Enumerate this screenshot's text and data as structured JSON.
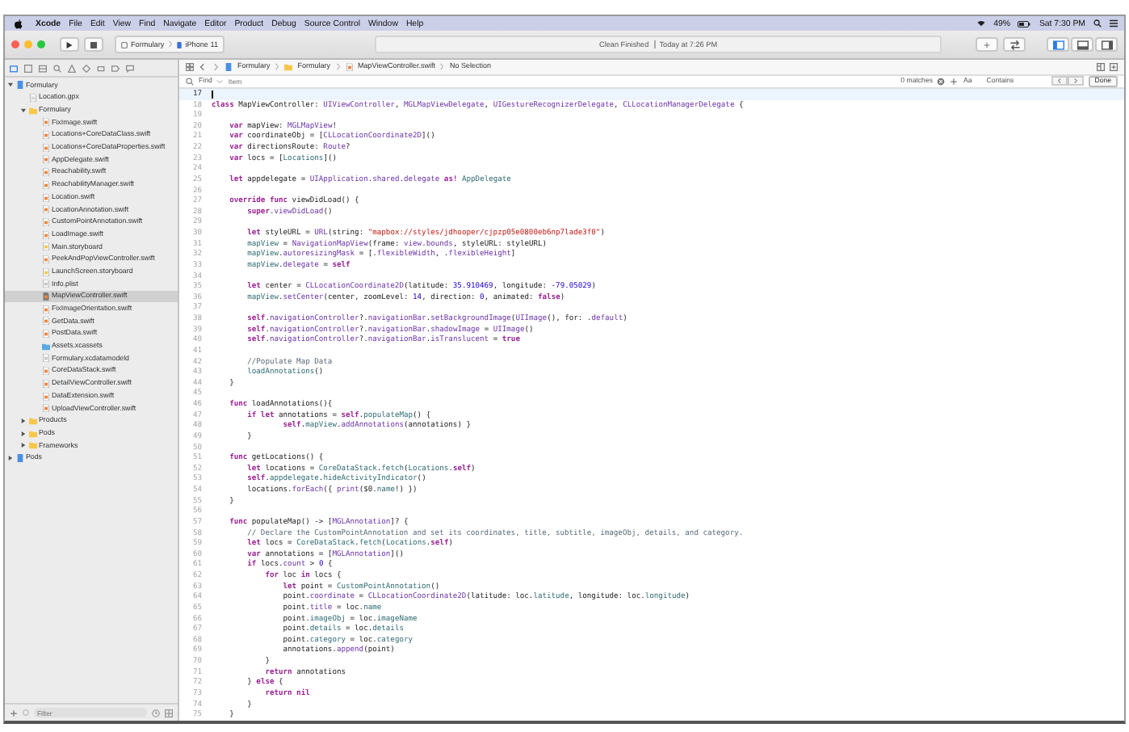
{
  "menu_bar": {
    "app": "Xcode",
    "items": [
      "File",
      "Edit",
      "View",
      "Find",
      "Navigate",
      "Editor",
      "Product",
      "Debug",
      "Source Control",
      "Window",
      "Help"
    ],
    "battery": "49%",
    "clock": "Sat 7:30 PM"
  },
  "toolbar": {
    "scheme": "Formulary",
    "device": "iPhone 11",
    "activity": "Clean Finished",
    "activity_time": "Today at 7:26 PM"
  },
  "jump_bar": [
    "Formulary",
    "Formulary",
    "MapViewController.swift",
    "No Selection"
  ],
  "find_bar": {
    "mode": "Find",
    "placeholder": "Item",
    "matches": "0 matches",
    "case": "Aa",
    "match_type": "Contains",
    "done": "Done"
  },
  "navigator": {
    "filter_placeholder": "Filter",
    "tree": [
      {
        "name": "Formulary",
        "kind": "project",
        "selected": false,
        "expanded": true,
        "children": [
          {
            "name": "Location.gpx",
            "kind": "gpx",
            "selected": false
          },
          {
            "name": "Formulary",
            "kind": "folder",
            "selected": false,
            "expanded": true,
            "children": [
              {
                "name": "FixImage.swift",
                "kind": "swift",
                "selected": false
              },
              {
                "name": "Locations+CoreDataClass.swift",
                "kind": "swift",
                "selected": false
              },
              {
                "name": "Locations+CoreDataProperties.swift",
                "kind": "swift",
                "selected": false
              },
              {
                "name": "AppDelegate.swift",
                "kind": "swift",
                "selected": false
              },
              {
                "name": "Reachability.swift",
                "kind": "swift",
                "selected": false
              },
              {
                "name": "ReachabilityManager.swift",
                "kind": "swift",
                "selected": false
              },
              {
                "name": "Location.swift",
                "kind": "swift",
                "selected": false
              },
              {
                "name": "LocationAnnotation.swift",
                "kind": "swift",
                "selected": false
              },
              {
                "name": "CustomPointAnnotation.swift",
                "kind": "swift",
                "selected": false
              },
              {
                "name": "LoadImage.swift",
                "kind": "swift",
                "selected": false
              },
              {
                "name": "Main.storyboard",
                "kind": "storyboard",
                "selected": false
              },
              {
                "name": "PeekAndPopViewController.swift",
                "kind": "swift",
                "selected": false
              },
              {
                "name": "LaunchScreen.storyboard",
                "kind": "storyboard",
                "selected": false
              },
              {
                "name": "Info.plist",
                "kind": "plist",
                "selected": false
              },
              {
                "name": "MapViewController.swift",
                "kind": "swift",
                "selected": true
              },
              {
                "name": "FixImageOrientation.swift",
                "kind": "swift",
                "selected": false
              },
              {
                "name": "GetData.swift",
                "kind": "swift",
                "selected": false
              },
              {
                "name": "PostData.swift",
                "kind": "swift",
                "selected": false
              },
              {
                "name": "Assets.xcassets",
                "kind": "assets",
                "selected": false
              },
              {
                "name": "Formulary.xcdatamodeld",
                "kind": "model",
                "selected": false
              },
              {
                "name": "CoreDataStack.swift",
                "kind": "swift",
                "selected": false
              },
              {
                "name": "DetailViewController.swift",
                "kind": "swift",
                "selected": false
              },
              {
                "name": "DataExtension.swift",
                "kind": "swift",
                "selected": false
              },
              {
                "name": "UploadViewController.swift",
                "kind": "swift",
                "selected": false
              }
            ]
          },
          {
            "name": "Products",
            "kind": "folder",
            "selected": false,
            "expanded": false
          },
          {
            "name": "Pods",
            "kind": "folder",
            "selected": false,
            "expanded": false
          },
          {
            "name": "Frameworks",
            "kind": "folder",
            "selected": false,
            "expanded": false
          }
        ]
      },
      {
        "name": "Pods",
        "kind": "project",
        "selected": false,
        "expanded": false
      }
    ]
  },
  "editor": {
    "lines": [
      {
        "number": "17",
        "current": true
      },
      {
        "number": "18",
        "current": false,
        "tokens": [
          {
            "kind": "kw",
            "text": "class"
          },
          {
            "kind": "plain",
            "text": " MapViewController: "
          },
          {
            "kind": "type",
            "text": "UIViewController"
          },
          {
            "kind": "plain",
            "text": ", "
          },
          {
            "kind": "type",
            "text": "MGLMapViewDelegate"
          },
          {
            "kind": "plain",
            "text": ", "
          },
          {
            "kind": "type",
            "text": "UIGestureRecognizerDelegate"
          },
          {
            "kind": "plain",
            "text": ", "
          },
          {
            "kind": "type",
            "text": "CLLocationManagerDelegate"
          },
          {
            "kind": "plain",
            "text": " {"
          }
        ]
      },
      {
        "number": "19",
        "current": false
      },
      {
        "number": "20",
        "current": false,
        "tokens": [
          {
            "kind": "kw",
            "text": "    var"
          },
          {
            "kind": "plain",
            "text": " mapView: "
          },
          {
            "kind": "type",
            "text": "MGLMapView"
          },
          {
            "kind": "plain",
            "text": "!"
          }
        ]
      },
      {
        "number": "21",
        "current": false,
        "tokens": [
          {
            "kind": "kw",
            "text": "    var"
          },
          {
            "kind": "plain",
            "text": " coordinateObj = ["
          },
          {
            "kind": "type",
            "text": "CLLocationCoordinate2D"
          },
          {
            "kind": "plain",
            "text": "]()"
          }
        ]
      },
      {
        "number": "22",
        "current": false,
        "tokens": [
          {
            "kind": "kw",
            "text": "    var"
          },
          {
            "kind": "plain",
            "text": " directionsRoute: "
          },
          {
            "kind": "type",
            "text": "Route"
          },
          {
            "kind": "plain",
            "text": "?"
          }
        ]
      },
      {
        "number": "23",
        "current": false,
        "tokens": [
          {
            "kind": "kw",
            "text": "    var"
          },
          {
            "kind": "plain",
            "text": " locs = ["
          },
          {
            "kind": "proj",
            "text": "Locations"
          },
          {
            "kind": "plain",
            "text": "]()"
          }
        ]
      },
      {
        "number": "24",
        "current": false
      },
      {
        "number": "25",
        "current": false,
        "tokens": [
          {
            "kind": "kw",
            "text": "    let"
          },
          {
            "kind": "plain",
            "text": " appdelegate = "
          },
          {
            "kind": "type",
            "text": "UIApplication"
          },
          {
            "kind": "plain",
            "text": "."
          },
          {
            "kind": "type",
            "text": "shared"
          },
          {
            "kind": "plain",
            "text": "."
          },
          {
            "kind": "type",
            "text": "delegate"
          },
          {
            "kind": "kw",
            "text": " as!"
          },
          {
            "kind": "proj",
            "text": " AppDelegate"
          }
        ]
      },
      {
        "number": "26",
        "current": false
      },
      {
        "number": "27",
        "current": false,
        "tokens": [
          {
            "kind": "kw",
            "text": "    override func"
          },
          {
            "kind": "plain",
            "text": " viewDidLoad() {"
          }
        ]
      },
      {
        "number": "28",
        "current": false,
        "tokens": [
          {
            "kind": "kw",
            "text": "        super"
          },
          {
            "kind": "plain",
            "text": "."
          },
          {
            "kind": "type",
            "text": "viewDidLoad"
          },
          {
            "kind": "plain",
            "text": "()"
          }
        ]
      },
      {
        "number": "29",
        "current": false
      },
      {
        "number": "30",
        "current": false,
        "tokens": [
          {
            "kind": "kw",
            "text": "        let"
          },
          {
            "kind": "plain",
            "text": " styleURL = "
          },
          {
            "kind": "type",
            "text": "URL"
          },
          {
            "kind": "plain",
            "text": "(string: "
          },
          {
            "kind": "str",
            "text": "\"mapbox://styles/jdhooper/cjpzp05e0800eb6np7lade3f0\""
          },
          {
            "kind": "plain",
            "text": ")"
          }
        ]
      },
      {
        "number": "31",
        "current": false,
        "tokens": [
          {
            "kind": "proj",
            "text": "        mapView"
          },
          {
            "kind": "plain",
            "text": " = "
          },
          {
            "kind": "type",
            "text": "NavigationMapView"
          },
          {
            "kind": "plain",
            "text": "(frame: "
          },
          {
            "kind": "type",
            "text": "view"
          },
          {
            "kind": "plain",
            "text": "."
          },
          {
            "kind": "type",
            "text": "bounds"
          },
          {
            "kind": "plain",
            "text": ", styleURL: styleURL)"
          }
        ]
      },
      {
        "number": "32",
        "current": false,
        "tokens": [
          {
            "kind": "proj",
            "text": "        mapView"
          },
          {
            "kind": "plain",
            "text": "."
          },
          {
            "kind": "type",
            "text": "autoresizingMask"
          },
          {
            "kind": "plain",
            "text": " = [."
          },
          {
            "kind": "type",
            "text": "flexibleWidth"
          },
          {
            "kind": "plain",
            "text": ", ."
          },
          {
            "kind": "type",
            "text": "flexibleHeight"
          },
          {
            "kind": "plain",
            "text": "]"
          }
        ]
      },
      {
        "number": "33",
        "current": false,
        "tokens": [
          {
            "kind": "proj",
            "text": "        mapView"
          },
          {
            "kind": "plain",
            "text": "."
          },
          {
            "kind": "type",
            "text": "delegate"
          },
          {
            "kind": "plain",
            "text": " = "
          },
          {
            "kind": "kw",
            "text": "self"
          }
        ]
      },
      {
        "number": "34",
        "current": false
      },
      {
        "number": "35",
        "current": false,
        "tokens": [
          {
            "kind": "kw",
            "text": "        let"
          },
          {
            "kind": "plain",
            "text": " center = "
          },
          {
            "kind": "type",
            "text": "CLLocationCoordinate2D"
          },
          {
            "kind": "plain",
            "text": "(latitude: "
          },
          {
            "kind": "num",
            "text": "35.910469"
          },
          {
            "kind": "plain",
            "text": ", longitude: "
          },
          {
            "kind": "num",
            "text": "-79.05029"
          },
          {
            "kind": "plain",
            "text": ")"
          }
        ]
      },
      {
        "number": "36",
        "current": false,
        "tokens": [
          {
            "kind": "proj",
            "text": "        mapView"
          },
          {
            "kind": "plain",
            "text": "."
          },
          {
            "kind": "type",
            "text": "setCenter"
          },
          {
            "kind": "plain",
            "text": "(center, zoomLevel: "
          },
          {
            "kind": "num",
            "text": "14"
          },
          {
            "kind": "plain",
            "text": ", direction: "
          },
          {
            "kind": "num",
            "text": "0"
          },
          {
            "kind": "plain",
            "text": ", animated: "
          },
          {
            "kind": "kw",
            "text": "false"
          },
          {
            "kind": "plain",
            "text": ")"
          }
        ]
      },
      {
        "number": "37",
        "current": false
      },
      {
        "number": "38",
        "current": false,
        "tokens": [
          {
            "kind": "kw",
            "text": "        self"
          },
          {
            "kind": "plain",
            "text": "."
          },
          {
            "kind": "type",
            "text": "navigationController"
          },
          {
            "kind": "plain",
            "text": "?."
          },
          {
            "kind": "type",
            "text": "navigationBar"
          },
          {
            "kind": "plain",
            "text": "."
          },
          {
            "kind": "type",
            "text": "setBackgroundImage"
          },
          {
            "kind": "plain",
            "text": "("
          },
          {
            "kind": "type",
            "text": "UIImage"
          },
          {
            "kind": "plain",
            "text": "(), for: ."
          },
          {
            "kind": "type",
            "text": "default"
          },
          {
            "kind": "plain",
            "text": ")"
          }
        ]
      },
      {
        "number": "39",
        "current": false,
        "tokens": [
          {
            "kind": "kw",
            "text": "        self"
          },
          {
            "kind": "plain",
            "text": "."
          },
          {
            "kind": "type",
            "text": "navigationController"
          },
          {
            "kind": "plain",
            "text": "?."
          },
          {
            "kind": "type",
            "text": "navigationBar"
          },
          {
            "kind": "plain",
            "text": "."
          },
          {
            "kind": "type",
            "text": "shadowImage"
          },
          {
            "kind": "plain",
            "text": " = "
          },
          {
            "kind": "type",
            "text": "UIImage"
          },
          {
            "kind": "plain",
            "text": "()"
          }
        ]
      },
      {
        "number": "40",
        "current": false,
        "tokens": [
          {
            "kind": "kw",
            "text": "        self"
          },
          {
            "kind": "plain",
            "text": "."
          },
          {
            "kind": "type",
            "text": "navigationController"
          },
          {
            "kind": "plain",
            "text": "?."
          },
          {
            "kind": "type",
            "text": "navigationBar"
          },
          {
            "kind": "plain",
            "text": "."
          },
          {
            "kind": "type",
            "text": "isTranslucent"
          },
          {
            "kind": "plain",
            "text": " = "
          },
          {
            "kind": "kw",
            "text": "true"
          }
        ]
      },
      {
        "number": "41",
        "current": false
      },
      {
        "number": "42",
        "current": false,
        "tokens": [
          {
            "kind": "com",
            "text": "        //Populate Map Data"
          }
        ]
      },
      {
        "number": "43",
        "current": false,
        "tokens": [
          {
            "kind": "proj",
            "text": "        loadAnnotations"
          },
          {
            "kind": "plain",
            "text": "()"
          }
        ]
      },
      {
        "number": "44",
        "current": false,
        "tokens": [
          {
            "kind": "plain",
            "text": "    }"
          }
        ]
      },
      {
        "number": "45",
        "current": false
      },
      {
        "number": "46",
        "current": false,
        "tokens": [
          {
            "kind": "kw",
            "text": "    func"
          },
          {
            "kind": "plain",
            "text": " loadAnnotations(){"
          }
        ]
      },
      {
        "number": "47",
        "current": false,
        "tokens": [
          {
            "kind": "kw",
            "text": "        if let"
          },
          {
            "kind": "plain",
            "text": " annotations = "
          },
          {
            "kind": "kw",
            "text": "self"
          },
          {
            "kind": "plain",
            "text": "."
          },
          {
            "kind": "proj",
            "text": "populateMap"
          },
          {
            "kind": "plain",
            "text": "() {"
          }
        ]
      },
      {
        "number": "48",
        "current": false,
        "tokens": [
          {
            "kind": "kw",
            "text": "                self"
          },
          {
            "kind": "plain",
            "text": "."
          },
          {
            "kind": "proj",
            "text": "mapView"
          },
          {
            "kind": "plain",
            "text": "."
          },
          {
            "kind": "type",
            "text": "addAnnotations"
          },
          {
            "kind": "plain",
            "text": "(annotations) }"
          }
        ]
      },
      {
        "number": "49",
        "current": false,
        "tokens": [
          {
            "kind": "plain",
            "text": "        }"
          }
        ]
      },
      {
        "number": "50",
        "current": false
      },
      {
        "number": "51",
        "current": false,
        "tokens": [
          {
            "kind": "kw",
            "text": "    func"
          },
          {
            "kind": "plain",
            "text": " getLocations() {"
          }
        ]
      },
      {
        "number": "52",
        "current": false,
        "tokens": [
          {
            "kind": "kw",
            "text": "        let"
          },
          {
            "kind": "plain",
            "text": " locations = "
          },
          {
            "kind": "proj",
            "text": "CoreDataStack"
          },
          {
            "kind": "plain",
            "text": "."
          },
          {
            "kind": "proj",
            "text": "fetch"
          },
          {
            "kind": "plain",
            "text": "("
          },
          {
            "kind": "proj",
            "text": "Locations"
          },
          {
            "kind": "plain",
            "text": "."
          },
          {
            "kind": "kw",
            "text": "self"
          },
          {
            "kind": "plain",
            "text": ")"
          }
        ]
      },
      {
        "number": "53",
        "current": false,
        "tokens": [
          {
            "kind": "kw",
            "text": "        self"
          },
          {
            "kind": "plain",
            "text": "."
          },
          {
            "kind": "proj",
            "text": "appdelegate"
          },
          {
            "kind": "plain",
            "text": "."
          },
          {
            "kind": "proj",
            "text": "hideActivityIndicator"
          },
          {
            "kind": "plain",
            "text": "()"
          }
        ]
      },
      {
        "number": "54",
        "current": false,
        "tokens": [
          {
            "kind": "plain",
            "text": "        locations."
          },
          {
            "kind": "type",
            "text": "forEach"
          },
          {
            "kind": "plain",
            "text": "({ "
          },
          {
            "kind": "type",
            "text": "print"
          },
          {
            "kind": "plain",
            "text": "($0."
          },
          {
            "kind": "proj",
            "text": "name"
          },
          {
            "kind": "plain",
            "text": "!) })"
          }
        ]
      },
      {
        "number": "55",
        "current": false,
        "tokens": [
          {
            "kind": "plain",
            "text": "    }"
          }
        ]
      },
      {
        "number": "56",
        "current": false
      },
      {
        "number": "57",
        "current": false,
        "tokens": [
          {
            "kind": "kw",
            "text": "    func"
          },
          {
            "kind": "plain",
            "text": " populateMap() -> ["
          },
          {
            "kind": "type",
            "text": "MGLAnnotation"
          },
          {
            "kind": "plain",
            "text": "]? {"
          }
        ]
      },
      {
        "number": "58",
        "current": false,
        "tokens": [
          {
            "kind": "com",
            "text": "        // Declare the CustomPointAnnotation and set its coordinates, title, subtitle, imageObj, details, and category."
          }
        ]
      },
      {
        "number": "59",
        "current": false,
        "tokens": [
          {
            "kind": "kw",
            "text": "        let"
          },
          {
            "kind": "plain",
            "text": " locs = "
          },
          {
            "kind": "proj",
            "text": "CoreDataStack"
          },
          {
            "kind": "plain",
            "text": "."
          },
          {
            "kind": "proj",
            "text": "fetch"
          },
          {
            "kind": "plain",
            "text": "("
          },
          {
            "kind": "proj",
            "text": "Locations"
          },
          {
            "kind": "plain",
            "text": "."
          },
          {
            "kind": "kw",
            "text": "self"
          },
          {
            "kind": "plain",
            "text": ")"
          }
        ]
      },
      {
        "number": "60",
        "current": false,
        "tokens": [
          {
            "kind": "kw",
            "text": "        var"
          },
          {
            "kind": "plain",
            "text": " annotations = ["
          },
          {
            "kind": "type",
            "text": "MGLAnnotation"
          },
          {
            "kind": "plain",
            "text": "]()"
          }
        ]
      },
      {
        "number": "61",
        "current": false,
        "tokens": [
          {
            "kind": "kw",
            "text": "        if"
          },
          {
            "kind": "plain",
            "text": " locs."
          },
          {
            "kind": "type",
            "text": "count"
          },
          {
            "kind": "plain",
            "text": " > "
          },
          {
            "kind": "num",
            "text": "0"
          },
          {
            "kind": "plain",
            "text": " {"
          }
        ]
      },
      {
        "number": "62",
        "current": false,
        "tokens": [
          {
            "kind": "kw",
            "text": "            for"
          },
          {
            "kind": "plain",
            "text": " loc "
          },
          {
            "kind": "kw",
            "text": "in"
          },
          {
            "kind": "plain",
            "text": " locs {"
          }
        ]
      },
      {
        "number": "63",
        "current": false,
        "tokens": [
          {
            "kind": "kw",
            "text": "                let"
          },
          {
            "kind": "plain",
            "text": " point = "
          },
          {
            "kind": "proj",
            "text": "CustomPointAnnotation"
          },
          {
            "kind": "plain",
            "text": "()"
          }
        ]
      },
      {
        "number": "64",
        "current": false,
        "tokens": [
          {
            "kind": "plain",
            "text": "                point."
          },
          {
            "kind": "type",
            "text": "coordinate"
          },
          {
            "kind": "plain",
            "text": " = "
          },
          {
            "kind": "type",
            "text": "CLLocationCoordinate2D"
          },
          {
            "kind": "plain",
            "text": "(latitude: loc."
          },
          {
            "kind": "proj",
            "text": "latitude"
          },
          {
            "kind": "plain",
            "text": ", longitude: loc."
          },
          {
            "kind": "proj",
            "text": "longitude"
          },
          {
            "kind": "plain",
            "text": ")"
          }
        ]
      },
      {
        "number": "65",
        "current": false,
        "tokens": [
          {
            "kind": "plain",
            "text": "                point."
          },
          {
            "kind": "type",
            "text": "title"
          },
          {
            "kind": "plain",
            "text": " = loc."
          },
          {
            "kind": "proj",
            "text": "name"
          }
        ]
      },
      {
        "number": "66",
        "current": false,
        "tokens": [
          {
            "kind": "plain",
            "text": "                point."
          },
          {
            "kind": "proj",
            "text": "imageObj"
          },
          {
            "kind": "plain",
            "text": " = loc."
          },
          {
            "kind": "proj",
            "text": "imageName"
          }
        ]
      },
      {
        "number": "67",
        "current": false,
        "tokens": [
          {
            "kind": "plain",
            "text": "                point."
          },
          {
            "kind": "proj",
            "text": "details"
          },
          {
            "kind": "plain",
            "text": " = loc."
          },
          {
            "kind": "proj",
            "text": "details"
          }
        ]
      },
      {
        "number": "68",
        "current": false,
        "tokens": [
          {
            "kind": "plain",
            "text": "                point."
          },
          {
            "kind": "proj",
            "text": "category"
          },
          {
            "kind": "plain",
            "text": " = loc."
          },
          {
            "kind": "proj",
            "text": "category"
          }
        ]
      },
      {
        "number": "69",
        "current": false,
        "tokens": [
          {
            "kind": "plain",
            "text": "                annotations."
          },
          {
            "kind": "type",
            "text": "append"
          },
          {
            "kind": "plain",
            "text": "(point)"
          }
        ]
      },
      {
        "number": "70",
        "current": false,
        "tokens": [
          {
            "kind": "plain",
            "text": "            }"
          }
        ]
      },
      {
        "number": "71",
        "current": false,
        "tokens": [
          {
            "kind": "kw",
            "text": "            return"
          },
          {
            "kind": "plain",
            "text": " annotations"
          }
        ]
      },
      {
        "number": "72",
        "current": false,
        "tokens": [
          {
            "kind": "plain",
            "text": "        } "
          },
          {
            "kind": "kw",
            "text": "else"
          },
          {
            "kind": "plain",
            "text": " {"
          }
        ]
      },
      {
        "number": "73",
        "current": false,
        "tokens": [
          {
            "kind": "kw",
            "text": "            return nil"
          }
        ]
      },
      {
        "number": "74",
        "current": false,
        "tokens": [
          {
            "kind": "plain",
            "text": "        }"
          }
        ]
      },
      {
        "number": "75",
        "current": false,
        "tokens": [
          {
            "kind": "plain",
            "text": "    }"
          }
        ]
      }
    ]
  }
}
